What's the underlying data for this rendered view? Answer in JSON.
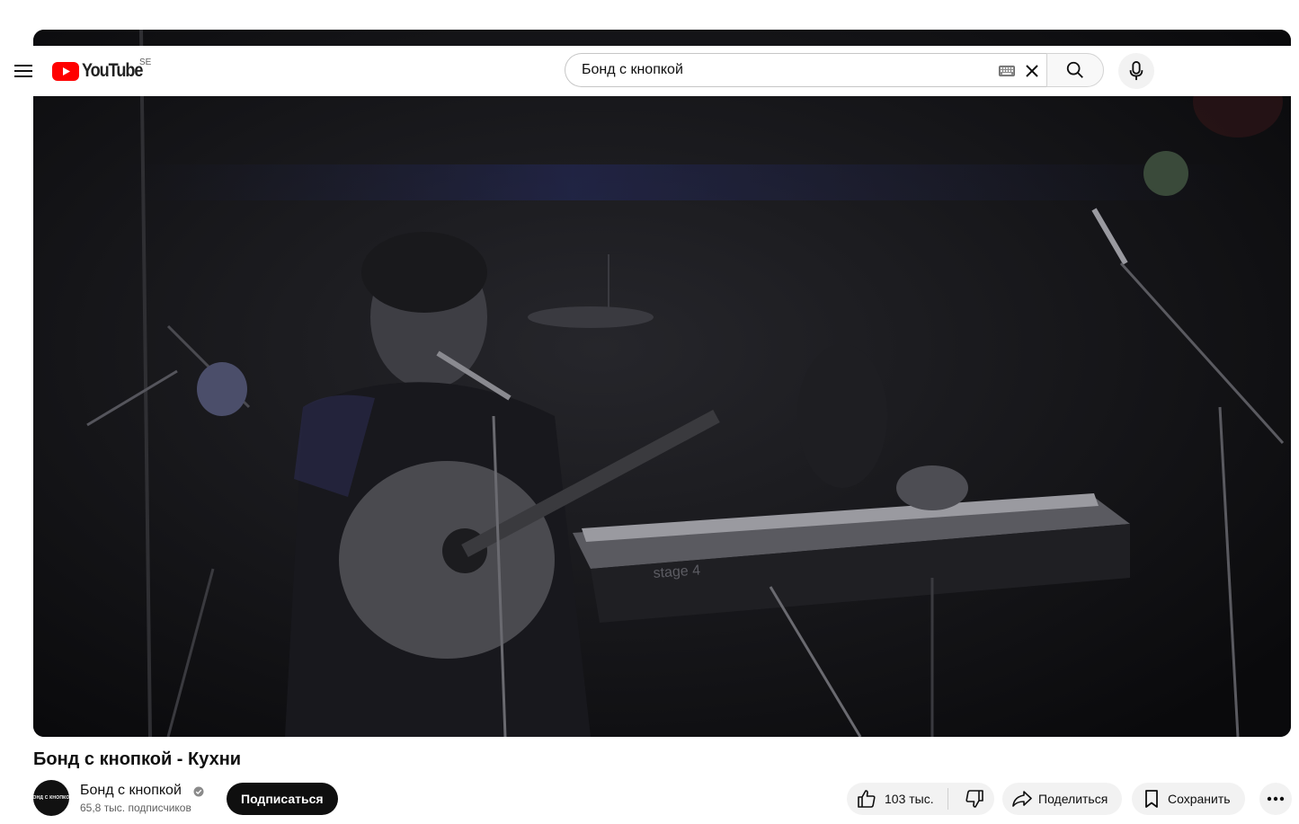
{
  "masthead": {
    "logo_text": "YouTube",
    "country_code": "SE",
    "search_value": "Бонд с кнопкой",
    "icons": [
      "menu-icon",
      "youtube-logo-icon",
      "keyboard-icon",
      "close-icon",
      "search-icon",
      "microphone-icon"
    ]
  },
  "video": {
    "title": "Бонд с кнопкой - Кухни",
    "overlay_text": "stage 4"
  },
  "channel": {
    "name": "Бонд с кнопкой",
    "subscribers": "65,8 тыс. подписчиков",
    "avatar_text": "БОНД С КНОПКОЙ",
    "subscribe_label": "Подписаться"
  },
  "actions": {
    "likes": "103 тыс.",
    "share_label": "Поделиться",
    "save_label": "Сохранить"
  },
  "colors": {
    "brand_red": "#ff0000",
    "text": "#0f0f0f",
    "muted": "#606060",
    "pill_bg": "#f2f2f2"
  }
}
